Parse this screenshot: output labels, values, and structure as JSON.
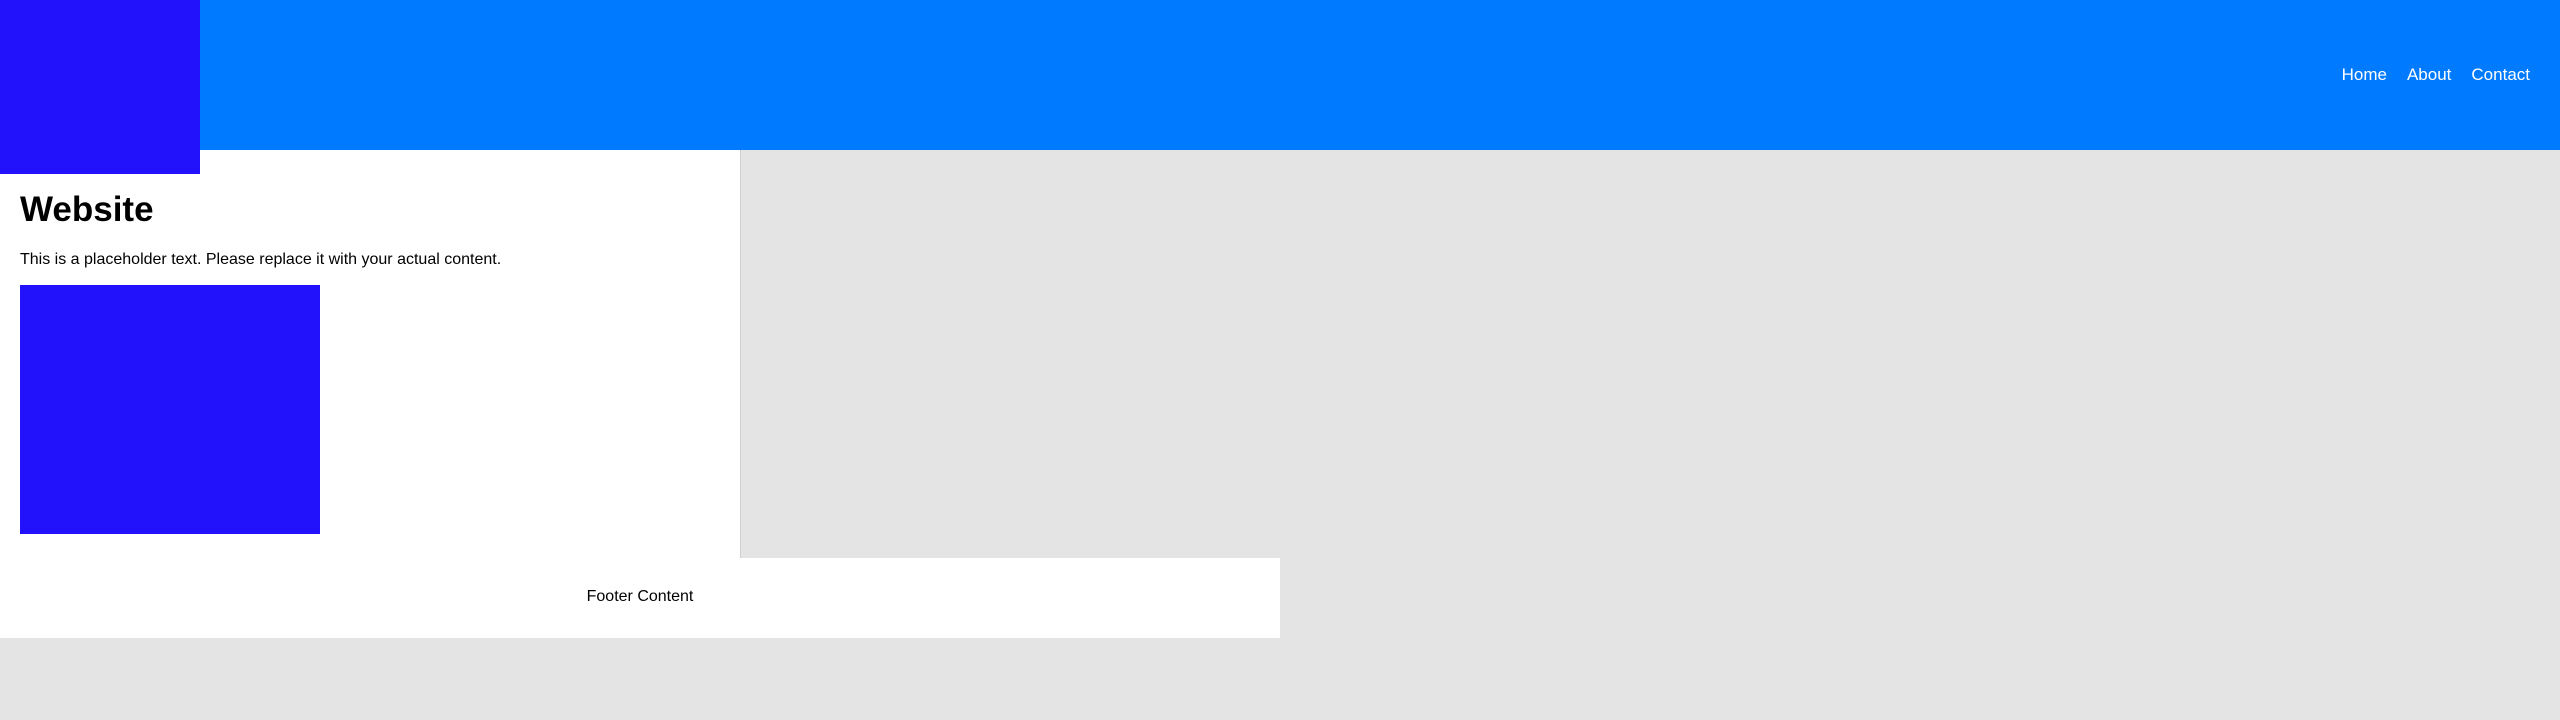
{
  "header": {
    "background_color": "#007bff",
    "logo": {
      "color": "#2212fb",
      "icon": "logo-block"
    },
    "nav": {
      "items": [
        {
          "label": "Home"
        },
        {
          "label": "About"
        },
        {
          "label": "Contact"
        }
      ]
    }
  },
  "main": {
    "title": "Website",
    "text": "This is a placeholder text. Please replace it with your actual content.",
    "image": {
      "color": "#2212fb"
    }
  },
  "footer": {
    "text": "Footer Content"
  },
  "colors": {
    "page_background": "#e4e4e4",
    "accent": "#007bff",
    "placeholder_block": "#2212fb"
  }
}
